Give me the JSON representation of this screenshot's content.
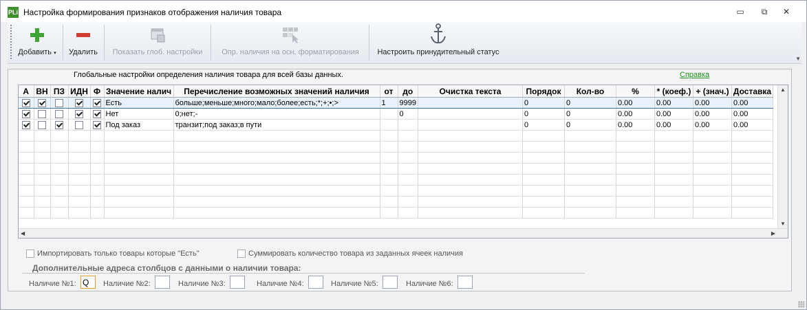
{
  "window": {
    "title": "Настройка формирования признаков отображения наличия товара",
    "icon_text": "PLi",
    "controls": {
      "minimize": "▭",
      "restore": "⧉",
      "close": "✕"
    }
  },
  "toolbar": {
    "add_label": "Добавить",
    "delete_label": "Удалить",
    "show_global_label": "Показать глоб. настройки",
    "detect_label": "Опр. наличия на осн, форматирования",
    "force_status_label": "Настроить принудительный статус",
    "icons": [
      "plus-icon",
      "minus-icon",
      "window-settings-icon",
      "grid-pointer-icon",
      "anchor-icon"
    ]
  },
  "panel": {
    "hint": "Глобальные настройки определения наличия товара для всей базы данных.",
    "help_link": "Справка"
  },
  "grid": {
    "columns": [
      "А",
      "ВН",
      "ПЗ",
      "ИДН",
      "Ф",
      "Значение налич",
      "Перечисление возможных значений наличия",
      "от",
      "до",
      "Очистка текста",
      "Порядок",
      "Кол-во",
      "%",
      "* (коеф.)",
      "+ (знач.)",
      "Доставка"
    ],
    "rows": [
      {
        "a": true,
        "vn": true,
        "pz": false,
        "idn": true,
        "f": true,
        "value": "Есть",
        "list": "больше;меньше;много;мало;более;есть;*;+;•;>",
        "from": "1",
        "to": "9999",
        "clean": "",
        "order": "0",
        "qty": "0",
        "pct": "0.00",
        "coef": "0.00",
        "add": "0.00",
        "delivery": "0.00"
      },
      {
        "a": true,
        "vn": false,
        "pz": false,
        "idn": true,
        "f": true,
        "value": "Нет",
        "list": "0;нет;-",
        "from": "",
        "to": "0",
        "clean": "",
        "order": "0",
        "qty": "0",
        "pct": "0.00",
        "coef": "0.00",
        "add": "0.00",
        "delivery": "0.00"
      },
      {
        "a": true,
        "vn": false,
        "pz": true,
        "idn": false,
        "f": true,
        "value": "Под заказ",
        "list": "транзит;под заказ;в пути",
        "from": "",
        "to": "",
        "clean": "",
        "order": "0",
        "qty": "0",
        "pct": "0.00",
        "coef": "0.00",
        "add": "0.00",
        "delivery": "0.00"
      }
    ],
    "empty_rows": 8
  },
  "options": {
    "import_only_existing": {
      "label": "Импортировать только товары которые \"Есть\"",
      "checked": false
    },
    "sum_quantity": {
      "label": "Суммировать количество товара из заданных ячеек наличия",
      "checked": false
    }
  },
  "extra": {
    "section_title": "Дополнительные адреса столбцов с данными о наличии товара:",
    "fields": [
      {
        "label": "Наличие №1:",
        "value": "Q"
      },
      {
        "label": "Наличие №2:",
        "value": ""
      },
      {
        "label": "Наличие №3:",
        "value": ""
      },
      {
        "label": "Наличие №4:",
        "value": ""
      },
      {
        "label": "Наличие №5:",
        "value": ""
      },
      {
        "label": "Наличие №6:",
        "value": ""
      }
    ]
  }
}
